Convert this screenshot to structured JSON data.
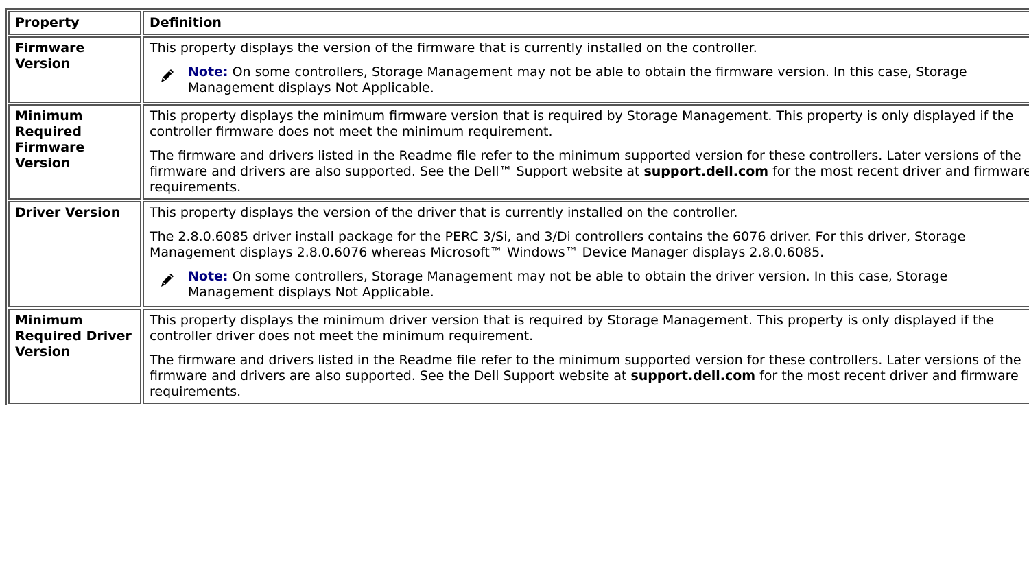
{
  "header": {
    "property": "Property",
    "definition": "Definition"
  },
  "rows": [
    {
      "property": "Firmware Version",
      "paragraphs": [
        "This property displays the version of the firmware that is currently installed on the controller."
      ],
      "note": {
        "label": "Note:",
        "text": " On some controllers, Storage Management may not be able to obtain the firmware version. In this case, Storage Management displays Not Applicable."
      }
    },
    {
      "property": "Minimum Required Firmware Version",
      "paragraphs": [
        "This property displays the minimum firmware version that is required by Storage Management. This property is only displayed if the controller firmware does not meet the minimum requirement."
      ],
      "link_paragraph": {
        "before": "The firmware and drivers listed in the Readme file refer to the minimum supported version for these controllers. Later versions of the firmware and drivers are also supported. See the Dell™ Support website at ",
        "link": "support.dell.com",
        "after": " for the most recent driver and firmware requirements."
      }
    },
    {
      "property": "Driver Version",
      "paragraphs": [
        "This property displays the version of the driver that is currently installed on the controller.",
        "The 2.8.0.6085 driver install package for the PERC 3/Si, and 3/Di controllers contains the 6076 driver. For this driver, Storage Management displays 2.8.0.6076 whereas Microsoft™ Windows™ Device Manager displays 2.8.0.6085."
      ],
      "note": {
        "label": "Note:",
        "text": " On some controllers, Storage Management may not be able to obtain the driver version. In this case, Storage Management displays Not Applicable."
      }
    },
    {
      "property": "Minimum Required Driver Version",
      "paragraphs": [
        "This property displays the minimum driver version that is required by Storage Management. This property is only displayed if the controller driver does not meet the minimum requirement."
      ],
      "link_paragraph": {
        "before": "The firmware and drivers listed in the Readme file refer to the minimum supported version for these controllers. Later versions of the firmware and drivers are also supported. See the Dell Support website at ",
        "link": "support.dell.com",
        "after": " for the most recent driver and firmware requirements."
      }
    }
  ],
  "colors": {
    "note_label": "#000080",
    "border": "#555555"
  },
  "icons": {
    "note": "pencil-note-icon"
  }
}
